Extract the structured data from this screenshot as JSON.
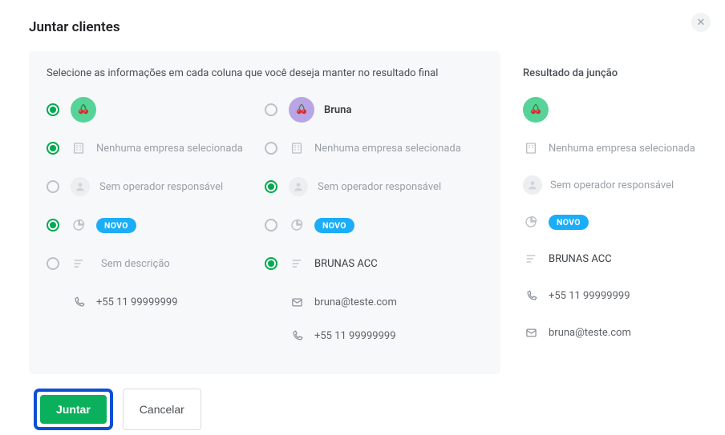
{
  "title": "Juntar clientes",
  "close_label": "✕",
  "instruction": "Selecione as informações em cada coluna que você deseja manter no resultado final",
  "col1": {
    "name": "",
    "company": "Nenhuma empresa selecionada",
    "operator": "Sem operador responsável",
    "status": "NOVO",
    "description": "Sem descrição",
    "phone": "+55 11 99999999"
  },
  "col2": {
    "name": "Bruna",
    "company": "Nenhuma empresa selecionada",
    "operator": "Sem operador responsável",
    "status": "NOVO",
    "description": "BRUNAS ACC",
    "email": "bruna@teste.com",
    "phone": "+55 11 99999999"
  },
  "result": {
    "title": "Resultado da junção",
    "company": "Nenhuma empresa selecionada",
    "operator": "Sem operador responsável",
    "status": "NOVO",
    "description": "BRUNAS ACC",
    "phone": "+55 11 99999999",
    "email": "bruna@teste.com"
  },
  "buttons": {
    "merge": "Juntar",
    "cancel": "Cancelar"
  }
}
